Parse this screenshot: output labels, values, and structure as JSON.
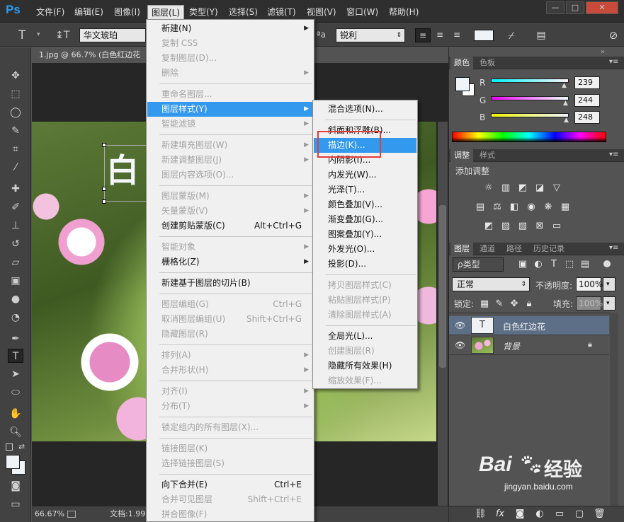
{
  "app": {
    "logo": "Ps"
  },
  "menubar": {
    "items": [
      "文件(F)",
      "编辑(E)",
      "图像(I)",
      "图层(L)",
      "类型(Y)",
      "选择(S)",
      "滤镜(T)",
      "视图(V)",
      "窗口(W)",
      "帮助(H)"
    ],
    "active": "图层(L)",
    "window_buttons": [
      "—",
      "□",
      "✕"
    ]
  },
  "options": {
    "tool_glyph": "T",
    "font_family": "华文琥珀",
    "aa_label": "ªa",
    "antialias": "锐利"
  },
  "document": {
    "tab_title": "1.jpg @ 66.7% (白色红边花",
    "zoom": "66.67%",
    "doc_info": "文档:1.99"
  },
  "canvas_text_glyph": "白",
  "layer_menu": {
    "items": [
      {
        "label": "新建(N)",
        "disabled": false,
        "submenu": true
      },
      {
        "label": "复制 CSS",
        "disabled": true
      },
      {
        "label": "复制图层(D)...",
        "disabled": true
      },
      {
        "label": "删除",
        "disabled": true,
        "submenu": true
      },
      {
        "sep": true
      },
      {
        "label": "重命名图层...",
        "disabled": true
      },
      {
        "label": "图层样式(Y)",
        "disabled": false,
        "submenu": true,
        "highlight": true
      },
      {
        "label": "智能滤镜",
        "disabled": true,
        "submenu": true
      },
      {
        "sep": true
      },
      {
        "label": "新建填充图层(W)",
        "disabled": true,
        "submenu": true
      },
      {
        "label": "新建调整图层(J)",
        "disabled": true,
        "submenu": true
      },
      {
        "label": "图层内容选项(O)...",
        "disabled": true
      },
      {
        "sep": true
      },
      {
        "label": "图层蒙版(M)",
        "disabled": true,
        "submenu": true
      },
      {
        "label": "矢量蒙版(V)",
        "disabled": true,
        "submenu": true
      },
      {
        "label": "创建剪贴蒙版(C)",
        "disabled": false,
        "shortcut": "Alt+Ctrl+G"
      },
      {
        "sep": true
      },
      {
        "label": "智能对象",
        "disabled": true,
        "submenu": true
      },
      {
        "label": "栅格化(Z)",
        "disabled": false,
        "submenu": true
      },
      {
        "sep": true
      },
      {
        "label": "新建基于图层的切片(B)",
        "disabled": false
      },
      {
        "sep": true
      },
      {
        "label": "图层编组(G)",
        "disabled": true,
        "shortcut": "Ctrl+G"
      },
      {
        "label": "取消图层编组(U)",
        "disabled": true,
        "shortcut": "Shift+Ctrl+G"
      },
      {
        "label": "隐藏图层(R)",
        "disabled": true
      },
      {
        "sep": true
      },
      {
        "label": "排列(A)",
        "disabled": true,
        "submenu": true
      },
      {
        "label": "合并形状(H)",
        "disabled": true,
        "submenu": true
      },
      {
        "sep": true
      },
      {
        "label": "对齐(I)",
        "disabled": true,
        "submenu": true
      },
      {
        "label": "分布(T)",
        "disabled": true,
        "submenu": true
      },
      {
        "sep": true
      },
      {
        "label": "锁定组内的所有图层(X)...",
        "disabled": true
      },
      {
        "sep": true
      },
      {
        "label": "链接图层(K)",
        "disabled": true
      },
      {
        "label": "选择链接图层(S)",
        "disabled": true
      },
      {
        "sep": true
      },
      {
        "label": "向下合并(E)",
        "disabled": false,
        "shortcut": "Ctrl+E"
      },
      {
        "label": "合并可见图层",
        "disabled": true,
        "shortcut": "Shift+Ctrl+E"
      },
      {
        "label": "拼合图像(F)",
        "disabled": true
      }
    ]
  },
  "style_menu": {
    "items": [
      {
        "label": "混合选项(N)...",
        "disabled": false
      },
      {
        "sep": true
      },
      {
        "label": "斜面和浮雕(B)...",
        "disabled": false
      },
      {
        "label": "描边(K)...",
        "disabled": false,
        "highlight": true
      },
      {
        "label": "内阴影(I)...",
        "disabled": false
      },
      {
        "label": "内发光(W)...",
        "disabled": false
      },
      {
        "label": "光泽(T)...",
        "disabled": false
      },
      {
        "label": "颜色叠加(V)...",
        "disabled": false
      },
      {
        "label": "渐变叠加(G)...",
        "disabled": false
      },
      {
        "label": "图案叠加(Y)...",
        "disabled": false
      },
      {
        "label": "外发光(O)...",
        "disabled": false
      },
      {
        "label": "投影(D)...",
        "disabled": false
      },
      {
        "sep": true
      },
      {
        "label": "拷贝图层样式(C)",
        "disabled": true
      },
      {
        "label": "粘贴图层样式(P)",
        "disabled": true
      },
      {
        "label": "清除图层样式(A)",
        "disabled": true
      },
      {
        "sep": true
      },
      {
        "label": "全局光(L)...",
        "disabled": false
      },
      {
        "label": "创建图层(R)",
        "disabled": true
      },
      {
        "label": "隐藏所有效果(H)",
        "disabled": false
      },
      {
        "label": "缩放效果(F)...",
        "disabled": true
      }
    ]
  },
  "color_panel": {
    "tabs": [
      "颜色",
      "色板"
    ],
    "r_label": "R",
    "g_label": "G",
    "b_label": "B",
    "r": "239",
    "g": "244",
    "b": "248",
    "r_value": 239,
    "g_value": 244,
    "b_value": 248,
    "swatch_color": "#eff4f8"
  },
  "adjust_panel": {
    "tabs": [
      "调整",
      "样式"
    ],
    "title": "添加调整"
  },
  "layers_panel": {
    "tabs": [
      "图层",
      "通道",
      "路径",
      "历史记录"
    ],
    "filter_label": "ρ类型",
    "blend_mode": "正常",
    "opacity_label": "不透明度:",
    "opacity": "100%",
    "lock_label": "锁定:",
    "fill_label": "填充:",
    "fill": "100%",
    "layers": [
      {
        "name": "白色红边花",
        "thumb": "T",
        "selected": true
      },
      {
        "name": "背景",
        "thumb": "",
        "selected": false
      }
    ]
  },
  "watermark": {
    "brand": "Bai",
    "brand_cn": "经验",
    "url": "jingyan.baidu.com"
  },
  "colors": {
    "highlight": "#3399ee",
    "annotation_box": "#e53b3b"
  }
}
